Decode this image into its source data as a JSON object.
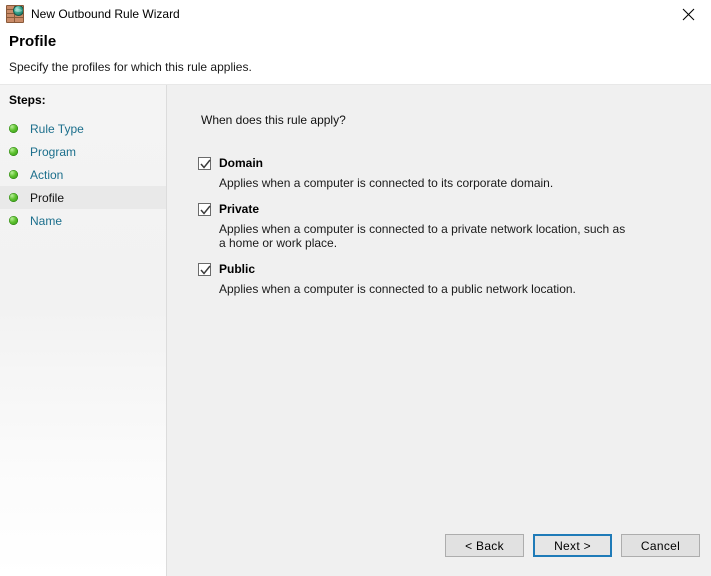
{
  "window": {
    "title": "New Outbound Rule Wizard",
    "icon": "firewall-globe-icon",
    "close_label": "✕"
  },
  "header": {
    "title": "Profile",
    "subtitle": "Specify the profiles for which this rule applies."
  },
  "sidebar": {
    "heading": "Steps:",
    "items": [
      {
        "label": "Rule Type",
        "active": false
      },
      {
        "label": "Program",
        "active": false
      },
      {
        "label": "Action",
        "active": false
      },
      {
        "label": "Profile",
        "active": true
      },
      {
        "label": "Name",
        "active": false
      }
    ]
  },
  "main": {
    "question": "When does this rule apply?",
    "options": [
      {
        "label": "Domain",
        "checked": true,
        "description": "Applies when a computer is connected to its corporate domain."
      },
      {
        "label": "Private",
        "checked": true,
        "description": "Applies when a computer is connected to a private network location, such as a home or work place."
      },
      {
        "label": "Public",
        "checked": true,
        "description": "Applies when a computer is connected to a public network location."
      }
    ]
  },
  "footer": {
    "back_label": "< Back",
    "next_label": "Next >",
    "cancel_label": "Cancel"
  },
  "colors": {
    "accent": "#1f7bb8",
    "step_link": "#1c6f8c",
    "content_bg": "#f0f0f0",
    "button_bg": "#e1e1e1"
  }
}
